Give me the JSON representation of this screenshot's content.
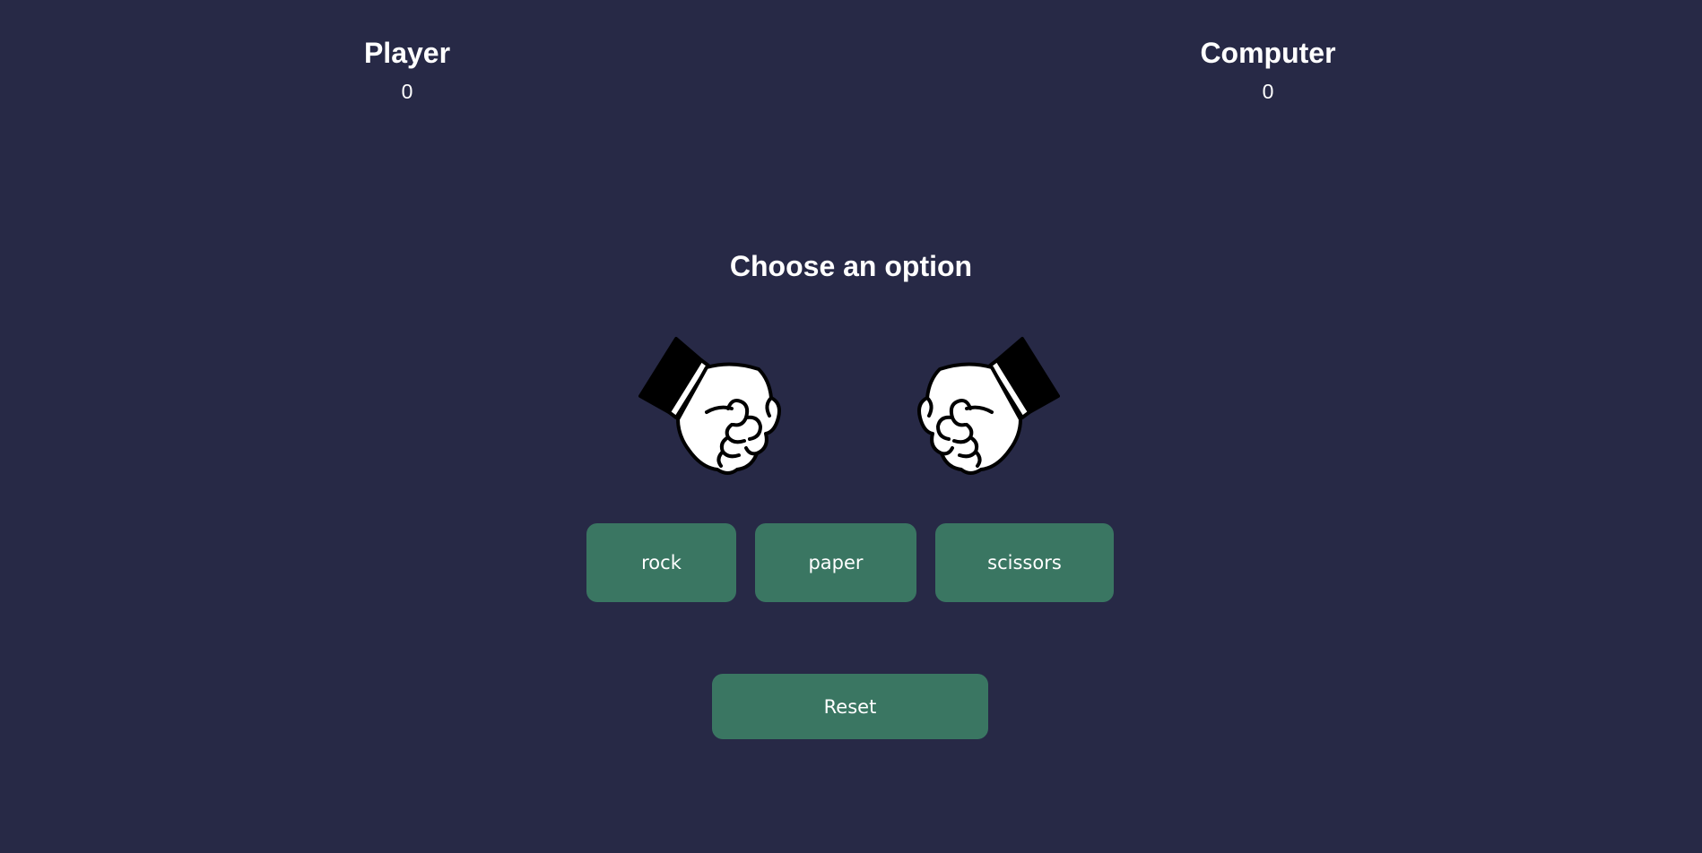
{
  "player": {
    "title": "Player",
    "score": "0"
  },
  "computer": {
    "title": "Computer",
    "score": "0"
  },
  "prompt": "Choose an option",
  "hands": {
    "player_icon": "rock-fist-icon",
    "computer_icon": "rock-fist-icon"
  },
  "choices": {
    "rock": "rock",
    "paper": "paper",
    "scissors": "scissors"
  },
  "reset_label": "Reset",
  "colors": {
    "background": "#272946",
    "button": "#3a7662",
    "text": "#ffffff"
  }
}
